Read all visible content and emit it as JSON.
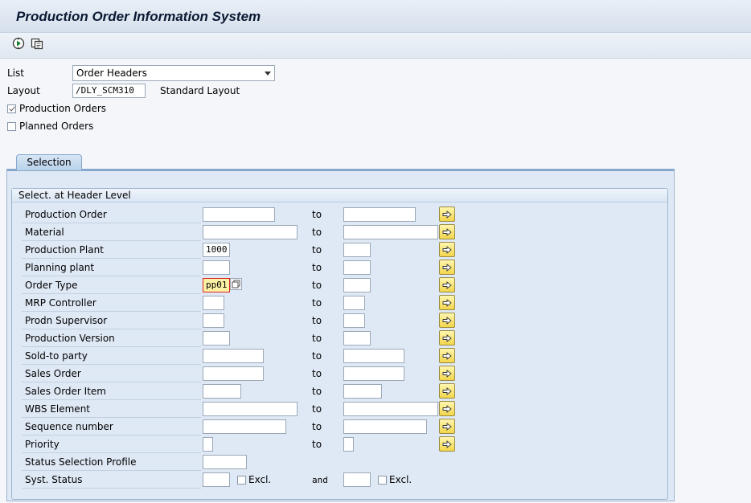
{
  "window": {
    "title": "Production Order Information System"
  },
  "toolbar": {
    "icons": [
      "execute-icon",
      "get-variant-icon"
    ]
  },
  "header": {
    "list_label": "List",
    "list_value": "Order Headers",
    "layout_label": "Layout",
    "layout_value": "/DLY_SCM310",
    "layout_desc": "Standard Layout",
    "production_orders_label": "Production Orders",
    "production_orders_checked": true,
    "planned_orders_label": "Planned Orders",
    "planned_orders_checked": false
  },
  "tab": {
    "label": "Selection"
  },
  "group": {
    "title": "Select. at Header Level"
  },
  "rows": [
    {
      "label": "Production Order",
      "from": "",
      "to_label": "to",
      "to": ""
    },
    {
      "label": "Material",
      "from": "",
      "to_label": "to",
      "to": ""
    },
    {
      "label": "Production Plant",
      "from": "1000",
      "to_label": "to",
      "to": ""
    },
    {
      "label": "Planning plant",
      "from": "",
      "to_label": "to",
      "to": ""
    },
    {
      "label": "Order Type",
      "from": "pp01",
      "to_label": "to",
      "to": ""
    },
    {
      "label": "MRP Controller",
      "from": "",
      "to_label": "to",
      "to": ""
    },
    {
      "label": "Prodn Supervisor",
      "from": "",
      "to_label": "to",
      "to": ""
    },
    {
      "label": "Production Version",
      "from": "",
      "to_label": "to",
      "to": ""
    },
    {
      "label": "Sold-to party",
      "from": "",
      "to_label": "to",
      "to": ""
    },
    {
      "label": "Sales Order",
      "from": "",
      "to_label": "to",
      "to": ""
    },
    {
      "label": "Sales Order Item",
      "from": "",
      "to_label": "to",
      "to": ""
    },
    {
      "label": "WBS Element",
      "from": "",
      "to_label": "to",
      "to": ""
    },
    {
      "label": "Sequence number",
      "from": "",
      "to_label": "to",
      "to": ""
    },
    {
      "label": "Priority",
      "from": "",
      "to_label": "to",
      "to": ""
    },
    {
      "label": "Status Selection Profile",
      "from": ""
    },
    {
      "label": "Syst. Status",
      "from": "",
      "excl_label": "Excl.",
      "and_label": "and",
      "to": "",
      "excl2_label": "Excl."
    }
  ]
}
